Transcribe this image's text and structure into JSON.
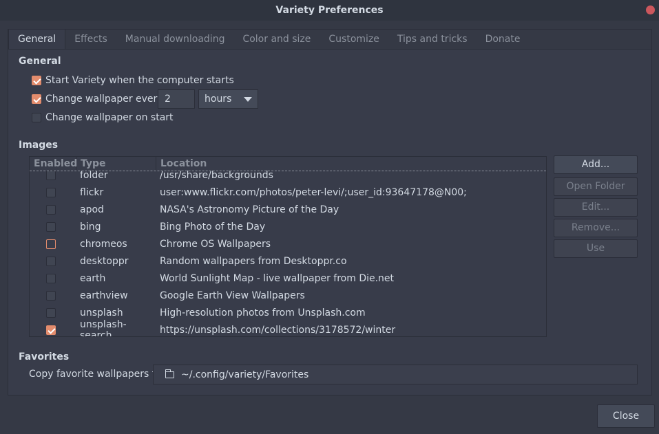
{
  "window": {
    "title": "Variety Preferences"
  },
  "tabs": [
    {
      "label": "General"
    },
    {
      "label": "Effects"
    },
    {
      "label": "Manual downloading"
    },
    {
      "label": "Color and size"
    },
    {
      "label": "Customize"
    },
    {
      "label": "Tips and tricks"
    },
    {
      "label": "Donate"
    }
  ],
  "general": {
    "title": "General",
    "start_on_boot": {
      "label": "Start Variety when the computer starts",
      "checked": true
    },
    "change_every": {
      "label": "Change wallpaper every",
      "checked": true,
      "value": "2",
      "unit": "hours"
    },
    "change_on_start": {
      "label": "Change wallpaper on start",
      "checked": false
    }
  },
  "images": {
    "title": "Images",
    "columns": [
      "Enabled",
      "Type",
      "Location"
    ],
    "rows": [
      {
        "enabled": false,
        "type": "folder",
        "location": "/usr/share/backgrounds"
      },
      {
        "enabled": false,
        "type": "flickr",
        "location": "user:www.flickr.com/photos/peter-levi/;user_id:93647178@N00;"
      },
      {
        "enabled": false,
        "type": "apod",
        "location": "NASA's Astronomy Picture of the Day"
      },
      {
        "enabled": false,
        "type": "bing",
        "location": "Bing Photo of the Day"
      },
      {
        "enabled": false,
        "type": "chromeos",
        "location": "Chrome OS Wallpapers"
      },
      {
        "enabled": false,
        "type": "desktoppr",
        "location": "Random wallpapers from Desktoppr.co"
      },
      {
        "enabled": false,
        "type": "earth",
        "location": "World Sunlight Map - live wallpaper from Die.net"
      },
      {
        "enabled": false,
        "type": "earthview",
        "location": "Google Earth View Wallpapers"
      },
      {
        "enabled": false,
        "type": "unsplash",
        "location": "High-resolution photos from Unsplash.com"
      },
      {
        "enabled": true,
        "type": "unsplash-search",
        "location": "https://unsplash.com/collections/3178572/winter"
      }
    ],
    "buttons": {
      "add": "Add...",
      "open_folder": "Open Folder",
      "edit": "Edit...",
      "remove": "Remove...",
      "use": "Use"
    }
  },
  "favorites": {
    "title": "Favorites",
    "label": "Copy favorite wallpapers to",
    "path": "~/.config/variety/Favorites",
    "icon": "folder-icon"
  },
  "footer": {
    "close_label": "Close"
  },
  "colors": {
    "accent": "#e38c6d",
    "close_dot": "#cc575d",
    "background": "#383c4a"
  }
}
